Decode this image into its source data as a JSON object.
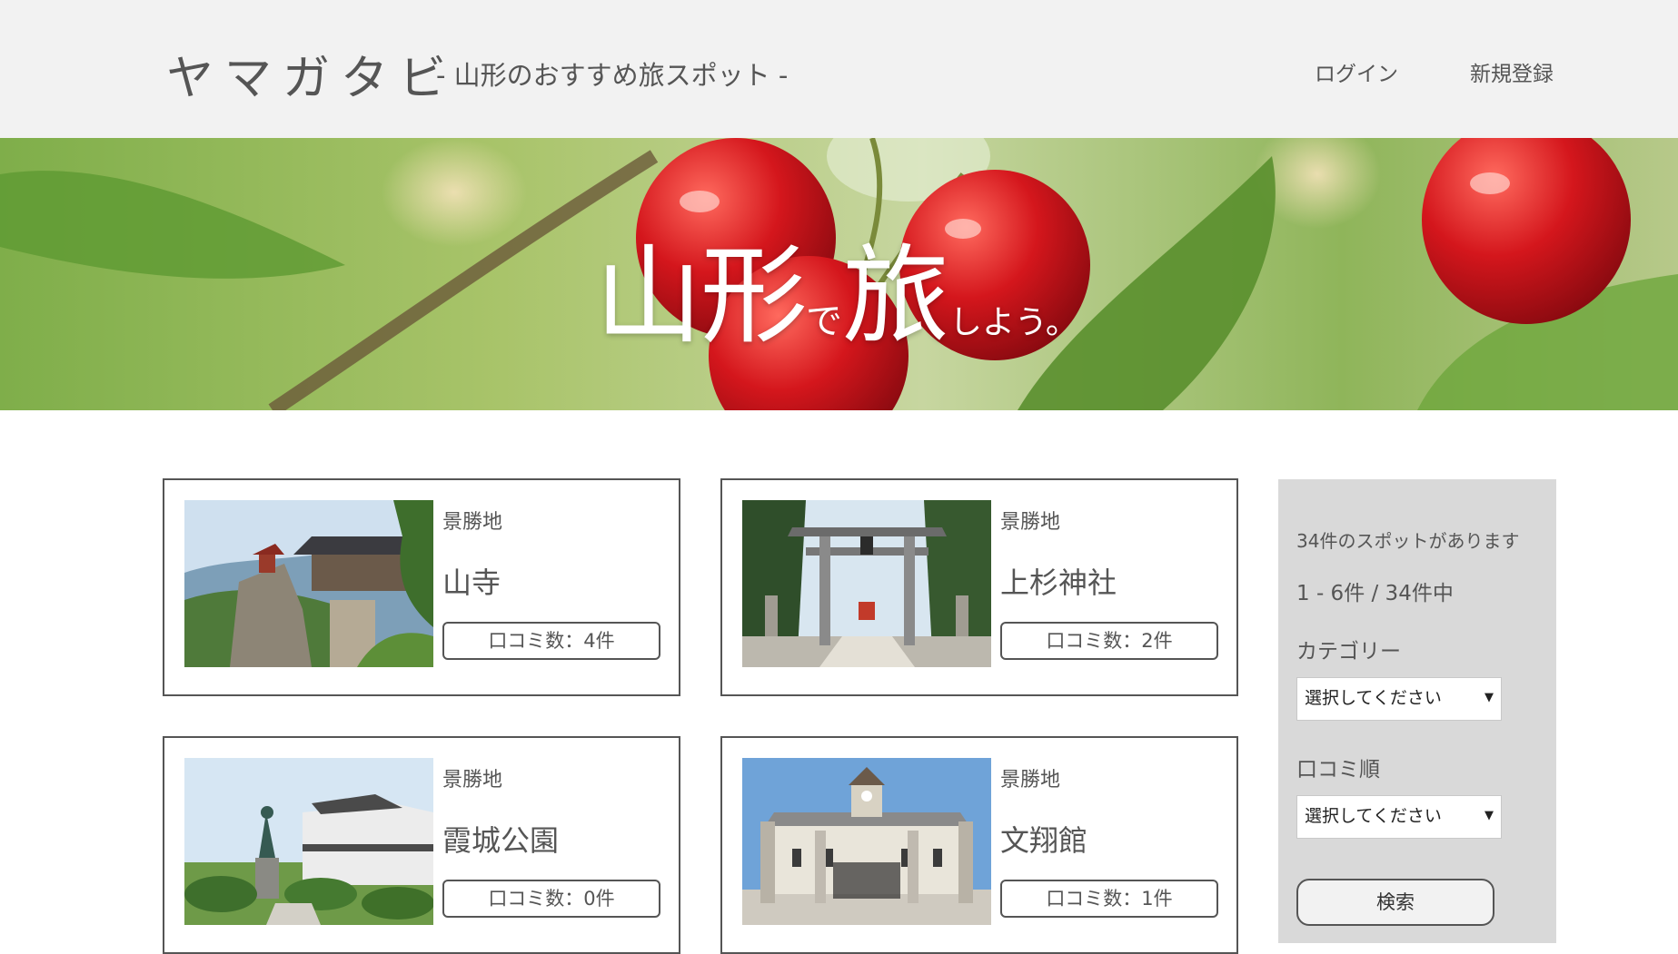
{
  "header": {
    "logo": "ヤマガタビ",
    "tagline": "- 山形のおすすめ旅スポット -",
    "nav": {
      "login": "ログイン",
      "register": "新規登録"
    }
  },
  "hero": {
    "part1": "山形",
    "part2": "で",
    "part3": "旅",
    "part4": "しよう。"
  },
  "spots": [
    {
      "category": "景勝地",
      "name": "山寺",
      "reviews": "口コミ数：4件"
    },
    {
      "category": "景勝地",
      "name": "上杉神社",
      "reviews": "口コミ数：2件"
    },
    {
      "category": "景勝地",
      "name": "霞城公園",
      "reviews": "口コミ数：0件"
    },
    {
      "category": "景勝地",
      "name": "文翔館",
      "reviews": "口コミ数：1件"
    }
  ],
  "sidebar": {
    "count_text": "34件のスポットがあります",
    "page_text": "1 - 6件 / 34件中",
    "category_label": "カテゴリー",
    "category_value": "選択してください",
    "sort_label": "口コミ順",
    "sort_value": "選択してください",
    "search_label": "検索"
  },
  "colors": {
    "header_bg": "#f2f2f2",
    "sidebar_bg": "#d9d9d9",
    "border": "#555555"
  }
}
